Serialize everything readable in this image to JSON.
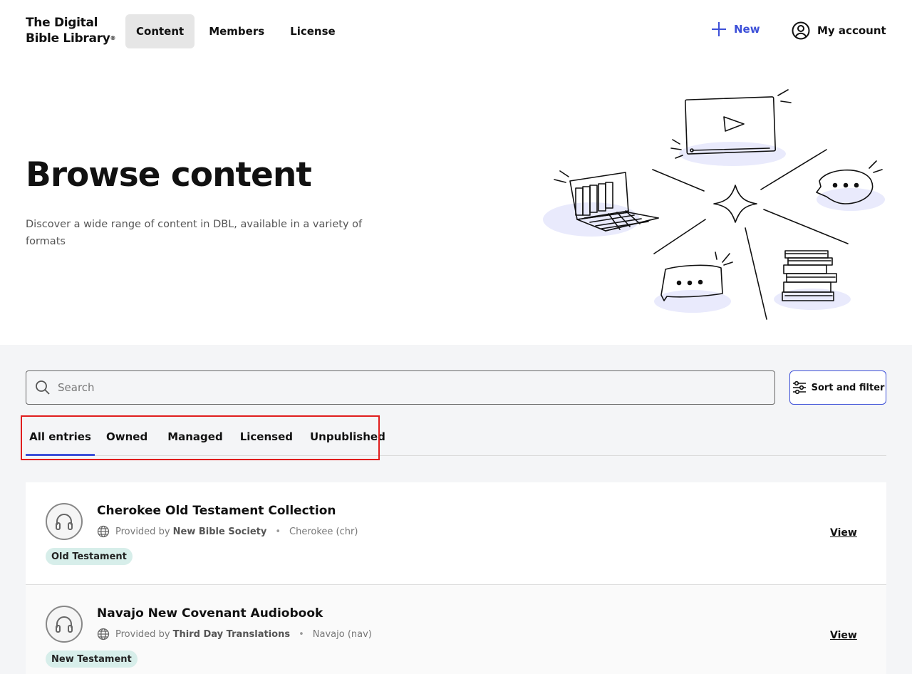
{
  "header": {
    "logo_line1": "The Digital",
    "logo_line2": "Bible Library",
    "logo_reg": "®",
    "nav": [
      {
        "label": "Content",
        "active": true
      },
      {
        "label": "Members",
        "active": false
      },
      {
        "label": "License",
        "active": false
      }
    ],
    "new_label": "New",
    "account_label": "My account"
  },
  "hero": {
    "title": "Browse content",
    "description": "Discover a wide range of content in DBL, available in a variety of formats"
  },
  "search": {
    "placeholder": "Search",
    "value": ""
  },
  "sort_filter_label": "Sort and filter",
  "tabs": [
    {
      "label": "All entries",
      "active": true
    },
    {
      "label": "Owned",
      "active": false
    },
    {
      "label": "Managed",
      "active": false
    },
    {
      "label": "Licensed",
      "active": false
    },
    {
      "label": "Unpublished",
      "active": false
    }
  ],
  "entries": [
    {
      "title": "Cherokee Old Testament Collection",
      "provided_by_prefix": "Provided by",
      "provider": "New Bible Society",
      "language": "Cherokee (chr)",
      "badge": "Old Testament",
      "view_label": "View",
      "icon": "headphones-icon"
    },
    {
      "title": "Navajo New Covenant Audiobook",
      "provided_by_prefix": "Provided by",
      "provider": "Third Day Translations",
      "language": "Navajo (nav)",
      "badge": "New Testament",
      "view_label": "View",
      "icon": "headphones-icon"
    }
  ],
  "colors": {
    "accent": "#3d50d8",
    "badge_bg": "#d7eeea",
    "highlight_box": "#e01e1e",
    "section_bg": "#f4f5f7"
  }
}
